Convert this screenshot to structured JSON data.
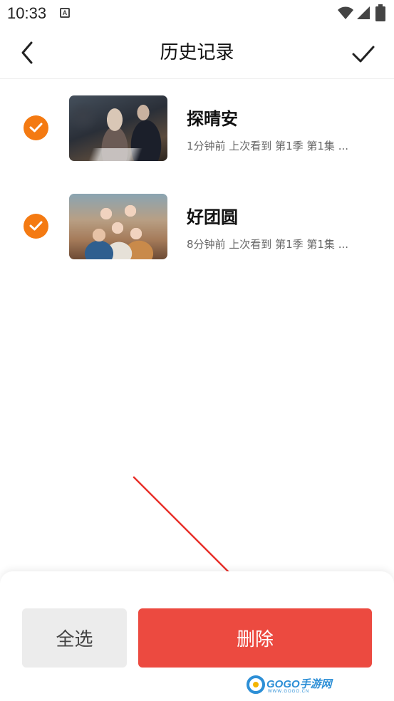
{
  "status_bar": {
    "time": "10:33",
    "notification_icon": "a-notification-icon",
    "icons": [
      "wifi-icon",
      "signal-icon",
      "battery-icon"
    ]
  },
  "header": {
    "title": "历史记录",
    "back_icon": "chevron-left-icon",
    "confirm_icon": "checkmark-icon"
  },
  "history": {
    "items": [
      {
        "title": "探晴安",
        "meta": "1分钟前  上次看到  第1季  第1集  ...",
        "selected": true
      },
      {
        "title": "好团圆",
        "meta": "8分钟前  上次看到  第1季  第1集  ...",
        "selected": true
      }
    ]
  },
  "bottom_bar": {
    "select_all_label": "全选",
    "delete_label": "删除"
  },
  "watermark": {
    "logo_text": "GOGO手游网",
    "sub_text": "WWW.GOGO.CN"
  },
  "colors": {
    "accent_orange": "#f47a12",
    "delete_red": "#ec4a40",
    "select_all_gray": "#ececec",
    "annotation_red": "#e8302a"
  }
}
